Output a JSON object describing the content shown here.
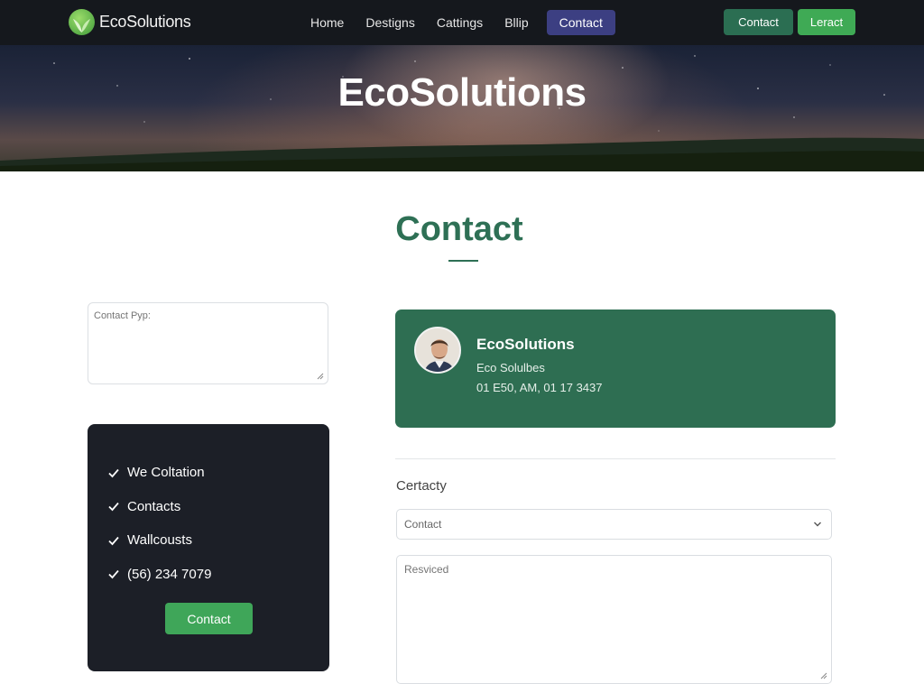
{
  "nav": {
    "brand": "EcoSolutions",
    "links": [
      "Home",
      "Destigns",
      "Cattings",
      "Bllip"
    ],
    "active_link": "Contact",
    "buttons": {
      "contact": "Contact",
      "lead": "Leract"
    }
  },
  "hero": {
    "title": "EcoSolutions"
  },
  "section": {
    "title": "Contact"
  },
  "left": {
    "prompt_placeholder": "Contact Pyp:",
    "list_items": [
      "We Coltation",
      "Contacts",
      "Wallcousts",
      "(56) 234 7079"
    ],
    "button": "Contact"
  },
  "profile": {
    "name": "EcoSolutions",
    "subtitle": "Eco Solulbes",
    "phone": "01 E50, AM,  01 17 3437"
  },
  "form": {
    "label": "Certacty",
    "select_value": "Contact",
    "message_placeholder": "Resviced"
  },
  "colors": {
    "nav_bg": "#15181d",
    "brand_green": "#2e6e52",
    "accent_green": "#3faa55",
    "active_nav": "#3c3f82",
    "dark_card": "#1c1f27"
  }
}
